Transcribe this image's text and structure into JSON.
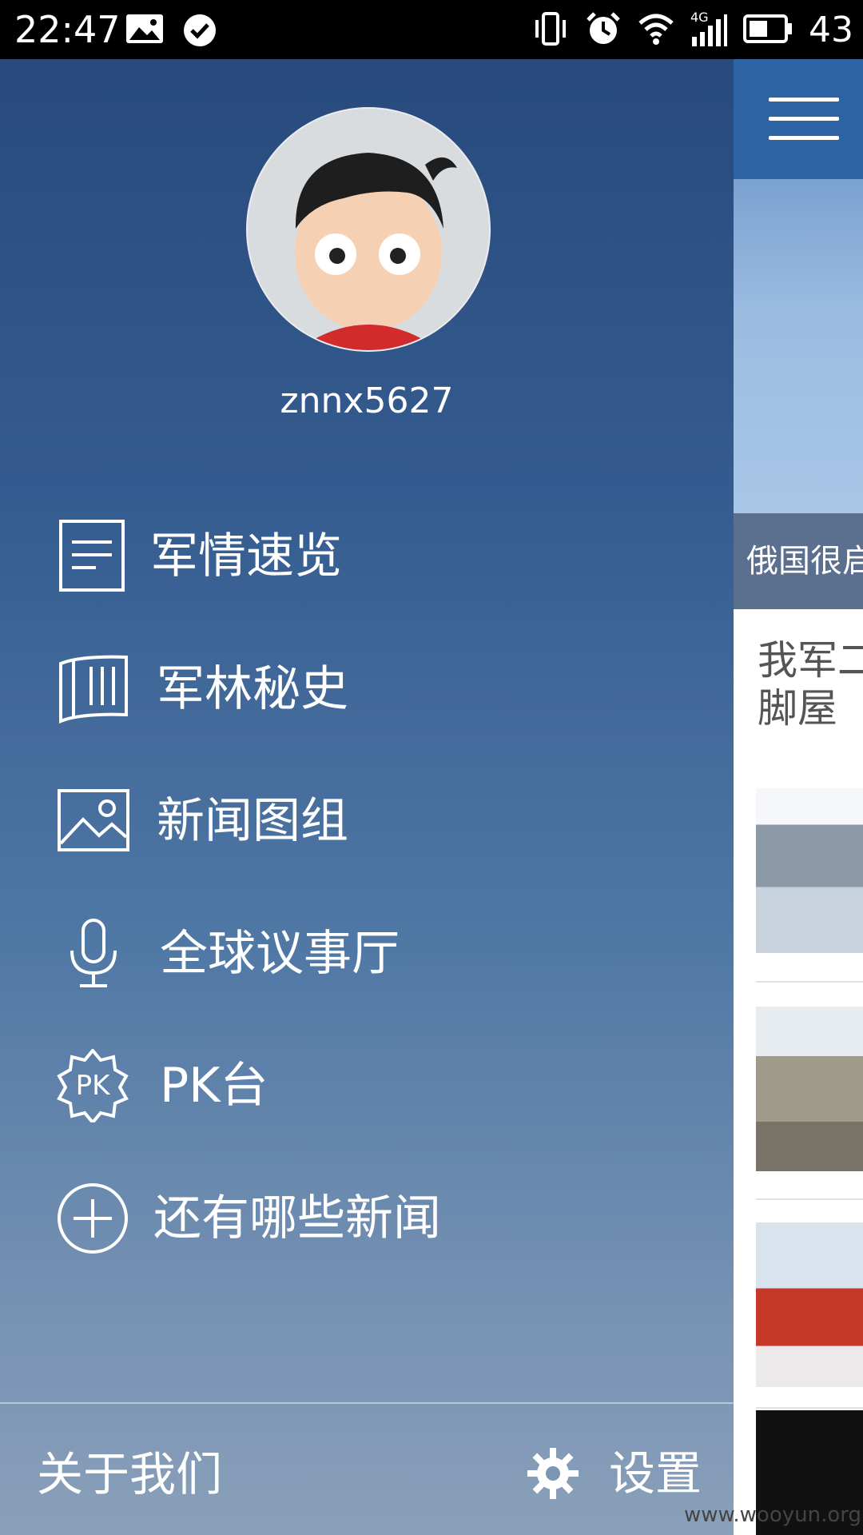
{
  "status_bar": {
    "time": "22:47",
    "battery": "43",
    "left_icons": [
      "image-icon",
      "check-circle-icon"
    ],
    "right_icons": [
      "vibrate-icon",
      "alarm-icon",
      "wifi-icon",
      "signal-4g-icon",
      "battery-icon"
    ],
    "signal_label": "4G"
  },
  "drawer": {
    "username": "znnx5627",
    "menu": [
      {
        "label": "军情速览",
        "icon": "document-icon"
      },
      {
        "label": "军林秘史",
        "icon": "book-icon"
      },
      {
        "label": "新闻图组",
        "icon": "image-icon"
      },
      {
        "label": "全球议事厅",
        "icon": "microphone-icon"
      },
      {
        "label": "PK台",
        "icon": "pk-badge-icon"
      },
      {
        "label": "还有哪些新闻",
        "icon": "add-circle-icon"
      }
    ],
    "pk_icon_text": "PK",
    "footer": {
      "about": "关于我们",
      "settings": "设置"
    }
  },
  "content": {
    "banner_caption": "俄国很启",
    "headline": "我军二\n脚屋"
  },
  "watermark": "www.wooyun.org",
  "colors": {
    "drawer_top": "#284a7d",
    "drawer_bottom": "#8aa0ba",
    "appbar": "#2f64a4"
  }
}
